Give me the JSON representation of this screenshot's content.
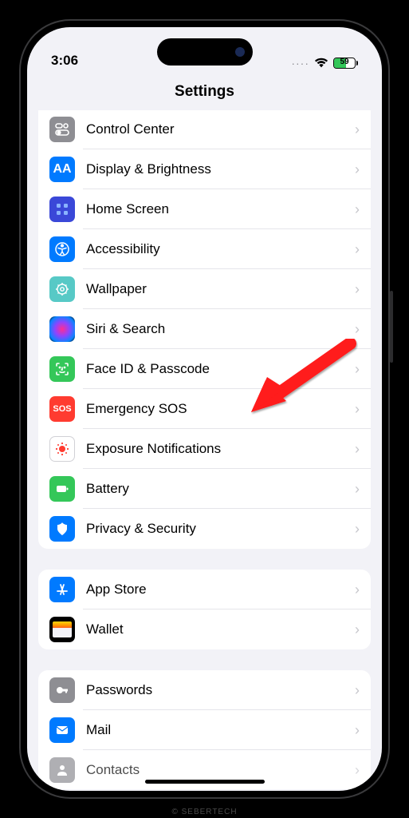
{
  "status": {
    "time": "3:06",
    "battery_pct": "59",
    "dots": "····"
  },
  "nav": {
    "title": "Settings"
  },
  "group1": [
    {
      "label": "Control Center",
      "icon": "control-center-icon",
      "bg": "bg-gray"
    },
    {
      "label": "Display & Brightness",
      "icon": "display-icon",
      "bg": "bg-blue"
    },
    {
      "label": "Home Screen",
      "icon": "home-screen-icon",
      "bg": "bg-indigo"
    },
    {
      "label": "Accessibility",
      "icon": "accessibility-icon",
      "bg": "bg-blue"
    },
    {
      "label": "Wallpaper",
      "icon": "wallpaper-icon",
      "bg": "bg-teal"
    },
    {
      "label": "Siri & Search",
      "icon": "siri-icon",
      "bg": "bg-siri"
    },
    {
      "label": "Face ID & Passcode",
      "icon": "faceid-icon",
      "bg": "bg-green"
    },
    {
      "label": "Emergency SOS",
      "icon": "sos-icon",
      "bg": "bg-red"
    },
    {
      "label": "Exposure Notifications",
      "icon": "exposure-icon",
      "bg": "bg-white"
    },
    {
      "label": "Battery",
      "icon": "battery-icon",
      "bg": "bg-green"
    },
    {
      "label": "Privacy & Security",
      "icon": "privacy-icon",
      "bg": "bg-blue"
    }
  ],
  "group2": [
    {
      "label": "App Store",
      "icon": "appstore-icon",
      "bg": "bg-blue"
    },
    {
      "label": "Wallet",
      "icon": "wallet-icon",
      "bg": "wallet"
    }
  ],
  "group3": [
    {
      "label": "Passwords",
      "icon": "passwords-icon",
      "bg": "bg-gray2"
    },
    {
      "label": "Mail",
      "icon": "mail-icon",
      "bg": "bg-blue"
    },
    {
      "label": "Contacts",
      "icon": "contacts-icon",
      "bg": "bg-gray"
    }
  ],
  "watermark": "© SEBERTECH"
}
